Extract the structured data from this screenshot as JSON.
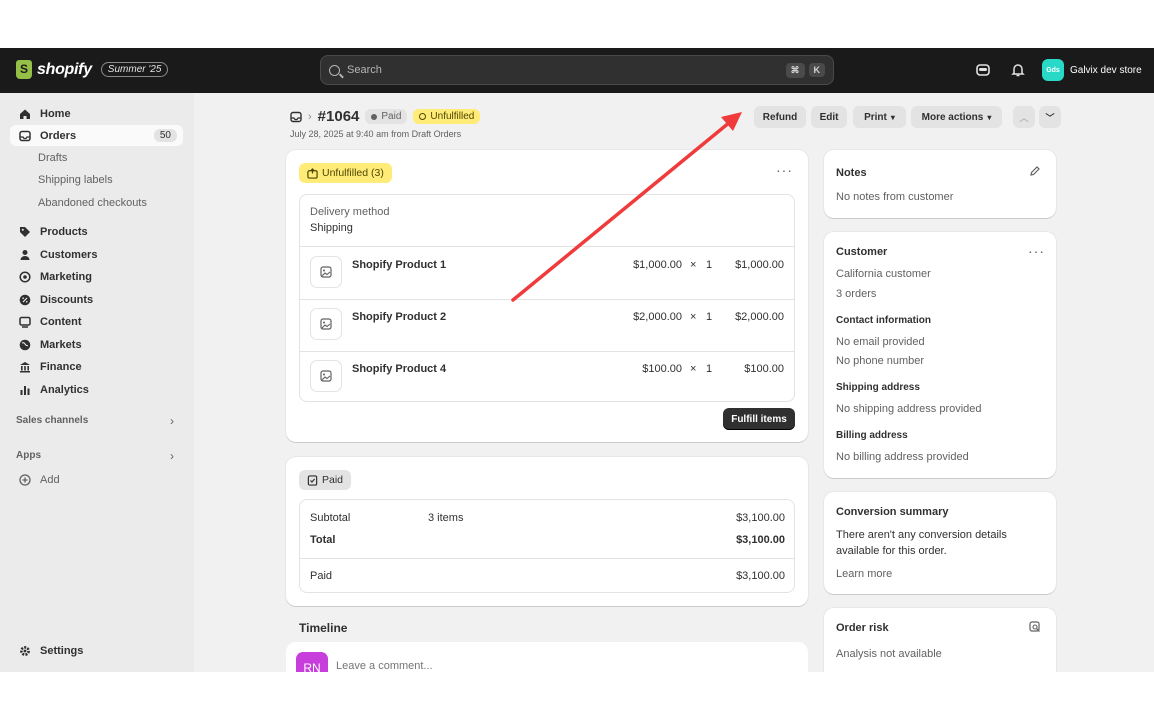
{
  "topbar": {
    "brand": "shopify",
    "edition": "Summer '25",
    "search_placeholder": "Search",
    "shortcut_keys": [
      "⌘",
      "K"
    ],
    "store_initials": "Gds",
    "store_name": "Galvix dev store"
  },
  "sidebar": {
    "items": [
      {
        "label": "Home",
        "icon": "home-icon"
      },
      {
        "label": "Orders",
        "icon": "inbox-icon",
        "count": "50"
      },
      {
        "label": "Products",
        "icon": "tag-icon"
      },
      {
        "label": "Customers",
        "icon": "person-icon"
      },
      {
        "label": "Marketing",
        "icon": "target-icon"
      },
      {
        "label": "Discounts",
        "icon": "discount-icon"
      },
      {
        "label": "Content",
        "icon": "content-icon"
      },
      {
        "label": "Markets",
        "icon": "globe-icon"
      },
      {
        "label": "Finance",
        "icon": "bank-icon"
      },
      {
        "label": "Analytics",
        "icon": "chart-icon"
      }
    ],
    "orders_sub": [
      "Drafts",
      "Shipping labels",
      "Abandoned checkouts"
    ],
    "sales_channels": "Sales channels",
    "apps": "Apps",
    "add": "Add",
    "settings": "Settings"
  },
  "order": {
    "number": "#1064",
    "paid_badge": "Paid",
    "unfulfilled_badge": "Unfulfilled",
    "subtitle": "July 28, 2025 at 9:40 am from Draft Orders",
    "actions": [
      "Refund",
      "Edit",
      "Print",
      "More actions"
    ]
  },
  "fulfillment": {
    "badge": "Unfulfilled (3)",
    "delivery_label": "Delivery method",
    "delivery_value": "Shipping",
    "items": [
      {
        "name": "Shopify Product 1",
        "price": "$1,000.00",
        "qty": "1",
        "total": "$1,000.00"
      },
      {
        "name": "Shopify Product 2",
        "price": "$2,000.00",
        "qty": "1",
        "total": "$2,000.00"
      },
      {
        "name": "Shopify Product 4",
        "price": "$100.00",
        "qty": "1",
        "total": "$100.00"
      }
    ],
    "times_symbol": "×",
    "fulfill_button": "Fulfill items"
  },
  "payment": {
    "badge": "Paid",
    "subtotal_label": "Subtotal",
    "subtotal_items": "3 items",
    "subtotal_value": "$3,100.00",
    "total_label": "Total",
    "total_value": "$3,100.00",
    "paid_label": "Paid",
    "paid_value": "$3,100.00"
  },
  "timeline": {
    "title": "Timeline",
    "avatar": "RN",
    "comment_placeholder": "Leave a comment..."
  },
  "notes": {
    "title": "Notes",
    "text": "No notes from customer"
  },
  "customer": {
    "title": "Customer",
    "name": "California customer",
    "orders": "3 orders",
    "contact_title": "Contact information",
    "email": "No email provided",
    "phone": "No phone number",
    "shipping_title": "Shipping address",
    "shipping": "No shipping address provided",
    "billing_title": "Billing address",
    "billing": "No billing address provided"
  },
  "conversion": {
    "title": "Conversion summary",
    "text_line1": "There aren't any conversion details",
    "text_line2": "available for this order.",
    "link": "Learn more"
  },
  "risk": {
    "title": "Order risk",
    "text": "Analysis not available"
  },
  "annotation": {
    "arrow_color": "#ef3b3b"
  }
}
